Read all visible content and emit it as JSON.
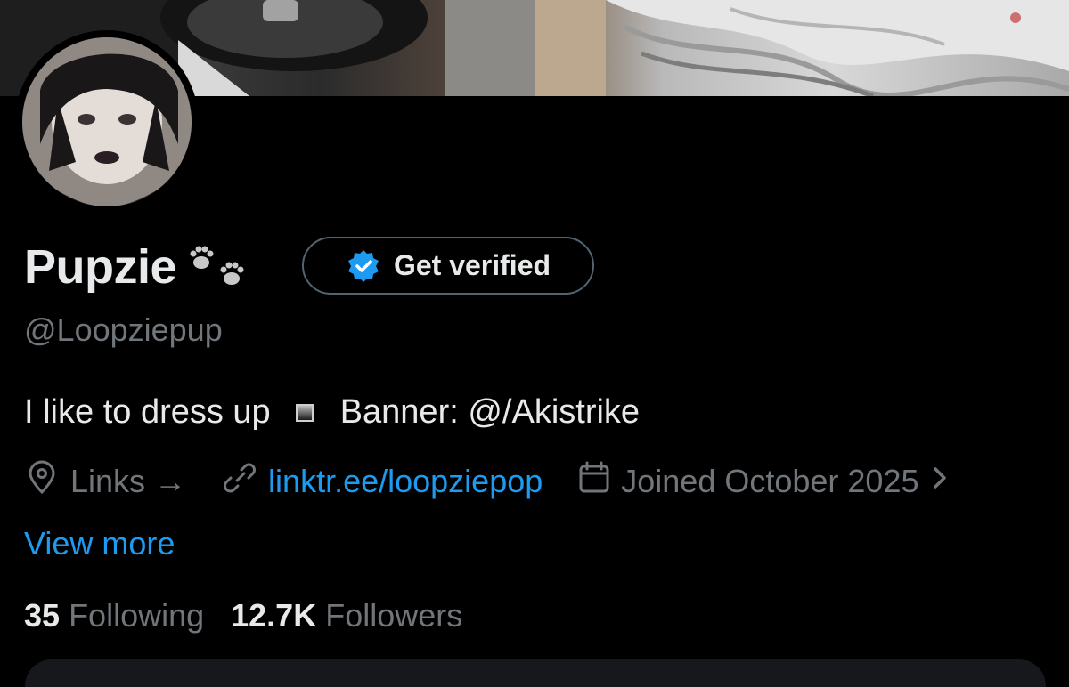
{
  "profile": {
    "display_name": "Pupzie",
    "handle": "@Loopziepup",
    "get_verified_label": "Get verified",
    "bio_left": "I like to dress up",
    "bio_right": "Banner: @/Akistrike"
  },
  "meta": {
    "links_label": "Links →",
    "website": "linktr.ee/loopziepop",
    "joined": "Joined October 2025"
  },
  "view_more": "View more",
  "stats": {
    "following_count": "35",
    "following_label": "Following",
    "followers_count": "12.7K",
    "followers_label": "Followers"
  },
  "icons": {
    "verified_badge": "verified-badge-icon",
    "location": "location-pin-icon",
    "link": "link-icon",
    "calendar": "calendar-icon",
    "chevron": "chevron-right-icon",
    "paws": "paw-prints-icon"
  },
  "colors": {
    "background": "#000000",
    "text_primary": "#e7e9ea",
    "text_secondary": "#71767b",
    "accent_blue": "#1d9bf0"
  }
}
